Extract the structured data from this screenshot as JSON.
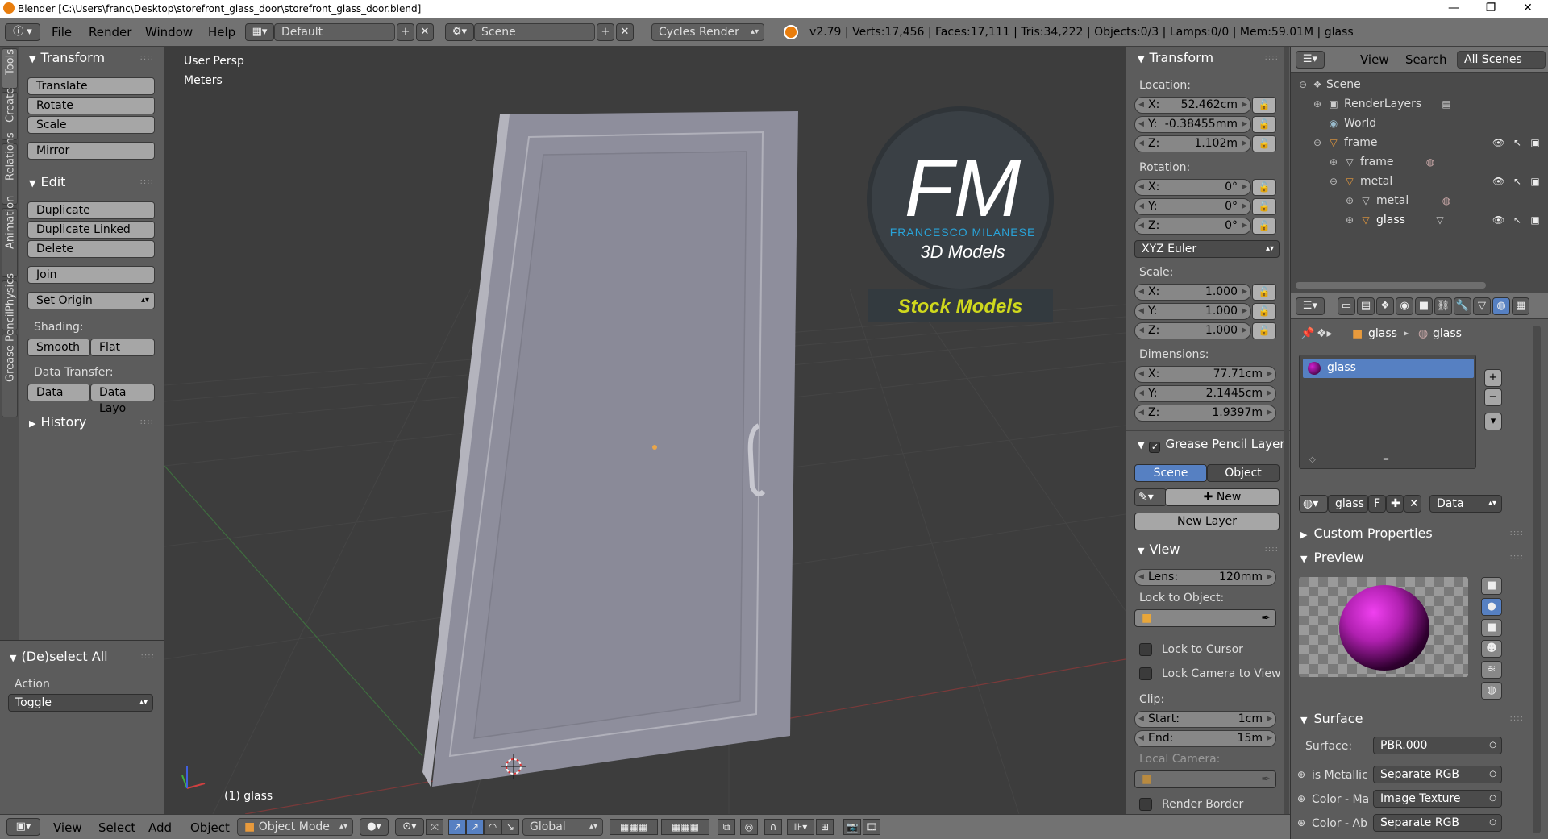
{
  "window": {
    "title": "Blender [C:\\Users\\franc\\Desktop\\storefront_glass_door\\storefront_glass_door.blend]",
    "minimize": "—",
    "maximize": "❐",
    "close": "✕"
  },
  "infobar": {
    "menus": [
      "File",
      "Render",
      "Window",
      "Help"
    ],
    "layout": "Default",
    "scene": "Scene",
    "engine": "Cycles Render",
    "stats": "v2.79 | Verts:17,456 | Faces:17,111 | Tris:34,222 | Objects:0/3 | Lamps:0/0 | Mem:59.01M | glass"
  },
  "tabs": [
    "Tools",
    "Create",
    "Relations",
    "Animation",
    "Physics",
    "Grease Pencil"
  ],
  "toolshelf": {
    "transform_title": "Transform",
    "transform_buttons": [
      "Translate",
      "Rotate",
      "Scale"
    ],
    "mirror": "Mirror",
    "edit_title": "Edit",
    "edit_buttons": [
      "Duplicate",
      "Duplicate Linked",
      "Delete"
    ],
    "join": "Join",
    "set_origin": "Set Origin",
    "shading_label": "Shading:",
    "smooth": "Smooth",
    "flat": "Flat",
    "data_transfer_label": "Data Transfer:",
    "data": "Data",
    "data_layout": "Data Layo",
    "history_title": "History",
    "deselect_title": "(De)select All",
    "action_label": "Action",
    "action_value": "Toggle"
  },
  "viewport": {
    "view_name": "User Persp",
    "units": "Meters",
    "selected": "(1) glass",
    "logo_letters": "FM",
    "logo_name": "FRANCESCO MILANESE",
    "logo_sub": "3D Models",
    "stock": "Stock Models"
  },
  "npanel": {
    "transform_title": "Transform",
    "location_label": "Location:",
    "location": [
      {
        "k": "X:",
        "v": "52.462cm"
      },
      {
        "k": "Y:",
        "v": "-0.38455mm"
      },
      {
        "k": "Z:",
        "v": "1.102m"
      }
    ],
    "rotation_label": "Rotation:",
    "rotation": [
      {
        "k": "X:",
        "v": "0°"
      },
      {
        "k": "Y:",
        "v": "0°"
      },
      {
        "k": "Z:",
        "v": "0°"
      }
    ],
    "rotation_mode": "XYZ Euler",
    "scale_label": "Scale:",
    "scale": [
      {
        "k": "X:",
        "v": "1.000"
      },
      {
        "k": "Y:",
        "v": "1.000"
      },
      {
        "k": "Z:",
        "v": "1.000"
      }
    ],
    "dimensions_label": "Dimensions:",
    "dimensions": [
      {
        "k": "X:",
        "v": "77.71cm"
      },
      {
        "k": "Y:",
        "v": "2.1445cm"
      },
      {
        "k": "Z:",
        "v": "1.9397m"
      }
    ],
    "gp_title": "Grease Pencil Layer",
    "gp_scene": "Scene",
    "gp_object": "Object",
    "gp_new": "New",
    "gp_new_layer": "New Layer",
    "view_title": "View",
    "lens_label": "Lens:",
    "lens_value": "120mm",
    "lock_object_label": "Lock to Object:",
    "lock_cursor": "Lock to Cursor",
    "lock_camera": "Lock Camera to View",
    "clip_label": "Clip:",
    "clip_start_label": "Start:",
    "clip_start": "1cm",
    "clip_end_label": "End:",
    "clip_end": "15m",
    "local_camera_label": "Local Camera:",
    "render_border": "Render Border"
  },
  "outliner": {
    "view": "View",
    "search": "Search",
    "filter": "All Scenes",
    "rows": [
      "Scene",
      "RenderLayers",
      "World",
      "frame",
      "frame",
      "metal",
      "metal",
      "glass"
    ]
  },
  "properties": {
    "breadcrumb_object": "glass",
    "breadcrumb_material": "glass",
    "slot_name": "glass",
    "material_name": "glass",
    "fake_user": "F",
    "link": "Data",
    "custom_props": "Custom Properties",
    "preview": "Preview",
    "surface_title": "Surface",
    "surface_label": "Surface:",
    "surface_value": "PBR.000",
    "inputs": [
      {
        "label": "is Metallic",
        "value": "Separate RGB"
      },
      {
        "label": "Color - Ma",
        "value": "Image Texture"
      },
      {
        "label": "Color - Ab",
        "value": "Separate RGB"
      }
    ]
  },
  "bottombar": {
    "menus": [
      "View",
      "Select",
      "Add",
      "Object"
    ],
    "mode": "Object Mode",
    "orientation": "Global"
  },
  "colors": {
    "accent": "#5680c2",
    "header": "#727272",
    "panel": "#5c5c5c",
    "viewport": "#3d3d3d"
  }
}
